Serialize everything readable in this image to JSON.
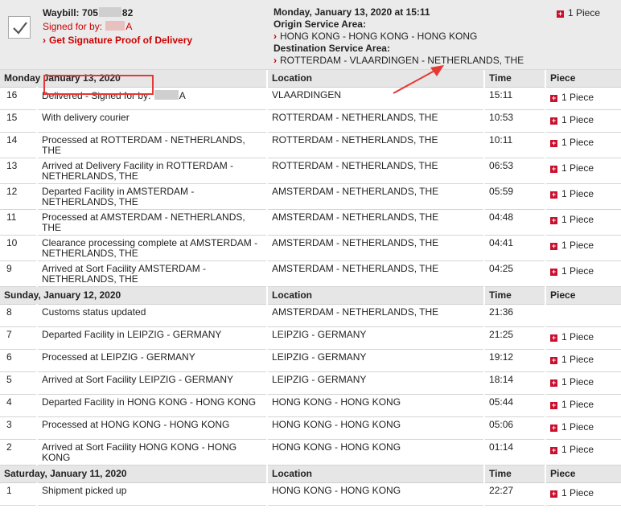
{
  "summary": {
    "waybill_label": "Waybill: 705",
    "waybill_suffix": "82",
    "signed_label": "Signed for by:",
    "signed_suffix": "A",
    "pod_link": "Get Signature Proof of Delivery",
    "date_time": "Monday, January 13, 2020 at 15:11",
    "origin_label": "Origin Service Area:",
    "origin_value": "HONG KONG - HONG KONG - HONG KONG",
    "dest_label": "Destination Service Area:",
    "dest_value": "ROTTERDAM - VLAARDINGEN - NETHERLANDS, THE",
    "piece": "1 Piece"
  },
  "table": {
    "col_location": "Location",
    "col_time": "Time",
    "col_piece": "Piece"
  },
  "days": [
    {
      "label_prefix": "Monday",
      "label_main": "January 13, 2020",
      "rows": [
        {
          "n": "16",
          "desc": "Delivered - Signed for by: ",
          "desc_suffix": "A",
          "redacted": true,
          "loc": "VLAARDINGEN",
          "time": "15:11",
          "piece": "1 Piece"
        },
        {
          "n": "15",
          "desc": "With delivery courier",
          "loc": "ROTTERDAM - NETHERLANDS, THE",
          "time": "10:53",
          "piece": "1 Piece"
        },
        {
          "n": "14",
          "desc": "Processed at ROTTERDAM - NETHERLANDS, THE",
          "loc": "ROTTERDAM - NETHERLANDS, THE",
          "time": "10:11",
          "piece": "1 Piece"
        },
        {
          "n": "13",
          "desc": "Arrived at Delivery Facility in ROTTERDAM - NETHERLANDS, THE",
          "loc": "ROTTERDAM - NETHERLANDS, THE",
          "time": "06:53",
          "piece": "1 Piece"
        },
        {
          "n": "12",
          "desc": "Departed Facility in AMSTERDAM - NETHERLANDS, THE",
          "loc": "AMSTERDAM - NETHERLANDS, THE",
          "time": "05:59",
          "piece": "1 Piece"
        },
        {
          "n": "11",
          "desc": "Processed at AMSTERDAM - NETHERLANDS, THE",
          "loc": "AMSTERDAM - NETHERLANDS, THE",
          "time": "04:48",
          "piece": "1 Piece"
        },
        {
          "n": "10",
          "desc": "Clearance processing complete at AMSTERDAM - NETHERLANDS, THE",
          "loc": "AMSTERDAM - NETHERLANDS, THE",
          "time": "04:41",
          "piece": "1 Piece"
        },
        {
          "n": "9",
          "desc": "Arrived at Sort Facility AMSTERDAM - NETHERLANDS, THE",
          "loc": "AMSTERDAM - NETHERLANDS, THE",
          "time": "04:25",
          "piece": "1 Piece"
        }
      ]
    },
    {
      "label_prefix": "",
      "label_main": "Sunday, January 12, 2020",
      "rows": [
        {
          "n": "8",
          "desc": "Customs status updated",
          "loc": "AMSTERDAM - NETHERLANDS, THE",
          "time": "21:36",
          "piece": ""
        },
        {
          "n": "7",
          "desc": "Departed Facility in LEIPZIG - GERMANY",
          "loc": "LEIPZIG - GERMANY",
          "time": "21:25",
          "piece": "1 Piece"
        },
        {
          "n": "6",
          "desc": "Processed at LEIPZIG - GERMANY",
          "loc": "LEIPZIG - GERMANY",
          "time": "19:12",
          "piece": "1 Piece"
        },
        {
          "n": "5",
          "desc": "Arrived at Sort Facility LEIPZIG - GERMANY",
          "loc": "LEIPZIG - GERMANY",
          "time": "18:14",
          "piece": "1 Piece"
        },
        {
          "n": "4",
          "desc": "Departed Facility in HONG KONG - HONG KONG",
          "loc": "HONG KONG - HONG KONG",
          "time": "05:44",
          "piece": "1 Piece"
        },
        {
          "n": "3",
          "desc": "Processed at HONG KONG - HONG KONG",
          "loc": "HONG KONG - HONG KONG",
          "time": "05:06",
          "piece": "1 Piece"
        },
        {
          "n": "2",
          "desc": "Arrived at Sort Facility HONG KONG - HONG KONG",
          "loc": "HONG KONG - HONG KONG",
          "time": "01:14",
          "piece": "1 Piece"
        }
      ]
    },
    {
      "label_prefix": "",
      "label_main": "Saturday, January 11, 2020",
      "rows": [
        {
          "n": "1",
          "desc": "Shipment picked up",
          "loc": "HONG KONG - HONG KONG",
          "time": "22:27",
          "piece": "1 Piece"
        }
      ]
    }
  ],
  "colors": {
    "accent": "#cc0000",
    "header_bg": "#e6e6e6",
    "summary_bg": "#ebebeb",
    "annotation": "#e53935"
  },
  "icons": {
    "check": "checkmark-icon",
    "plus": "plus-square-icon",
    "chevron": "chevron-right-icon"
  }
}
